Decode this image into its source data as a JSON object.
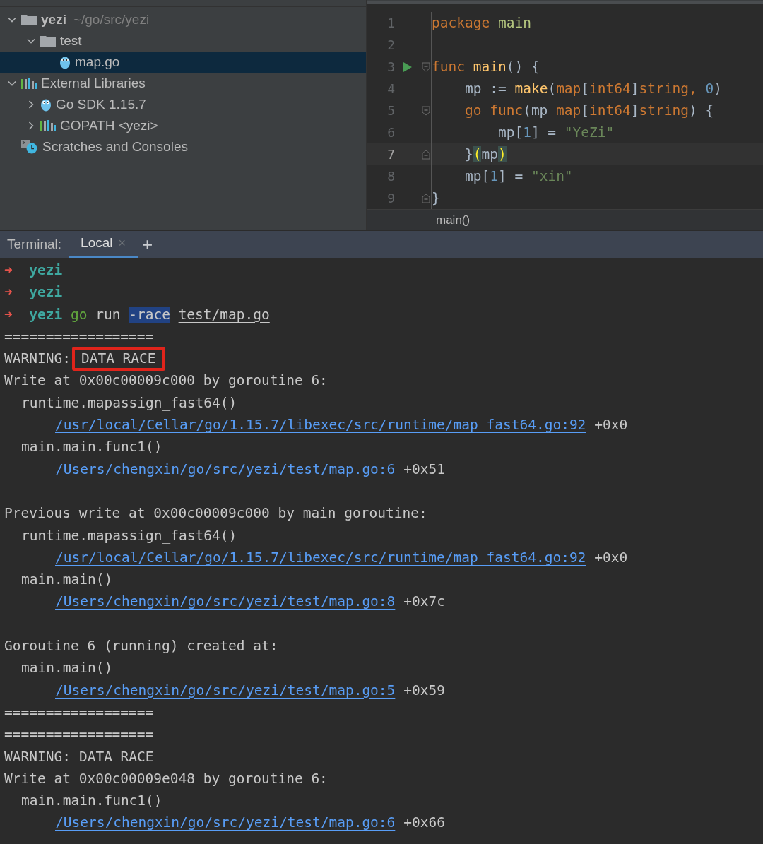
{
  "project_tree": [
    {
      "label": "yezi",
      "hint": "~/go/src/yezi",
      "kind": "project",
      "expanded": true,
      "selected": false,
      "children": [
        {
          "label": "test",
          "kind": "folder",
          "expanded": true,
          "selected": false,
          "children": [
            {
              "label": "map.go",
              "kind": "gofile",
              "selected": true
            }
          ]
        }
      ]
    },
    {
      "label": "External Libraries",
      "kind": "library",
      "expanded": true,
      "selected": false,
      "children": [
        {
          "label": "Go SDK 1.15.7",
          "kind": "gofile",
          "expanded": false,
          "selected": false
        },
        {
          "label": "GOPATH <yezi>",
          "kind": "library",
          "expanded": false,
          "selected": false
        }
      ]
    },
    {
      "label": "Scratches and Consoles",
      "kind": "scratches",
      "selected": false
    }
  ],
  "editor": {
    "lines": [
      {
        "number": "1",
        "current": false,
        "tokens": [
          {
            "t": "package ",
            "kind": "keyword"
          },
          {
            "t": "main",
            "kind": "pkg"
          }
        ]
      },
      {
        "number": "2",
        "current": false
      },
      {
        "number": "3",
        "current": false,
        "markers": [
          {
            "kind": "run"
          },
          {
            "kind": "fold_start"
          }
        ],
        "tokens": [
          {
            "t": "func ",
            "kind": "keyword"
          },
          {
            "t": "main",
            "kind": "func"
          },
          {
            "t": "() {",
            "kind": "plain"
          }
        ]
      },
      {
        "number": "4",
        "current": false,
        "tokens": [
          {
            "t": "    mp := ",
            "kind": "plain"
          },
          {
            "t": "make",
            "kind": "func"
          },
          {
            "t": "(",
            "kind": "plain"
          },
          {
            "t": "map",
            "kind": "keyword"
          },
          {
            "t": "[",
            "kind": "plain"
          },
          {
            "t": "int64",
            "kind": "keyword"
          },
          {
            "t": "]",
            "kind": "plain"
          },
          {
            "t": "string, ",
            "kind": "keyword"
          },
          {
            "t": "0",
            "kind": "number"
          },
          {
            "t": ")",
            "kind": "plain"
          }
        ]
      },
      {
        "number": "5",
        "current": false,
        "markers": [
          {
            "kind": "fold_start"
          }
        ],
        "tokens": [
          {
            "t": "    go func",
            "kind": "keyword"
          },
          {
            "t": "(mp ",
            "kind": "plain"
          },
          {
            "t": "map",
            "kind": "keyword"
          },
          {
            "t": "[",
            "kind": "plain"
          },
          {
            "t": "int64",
            "kind": "keyword"
          },
          {
            "t": "]",
            "kind": "plain"
          },
          {
            "t": "string",
            "kind": "keyword"
          },
          {
            "t": ") {",
            "kind": "plain"
          }
        ]
      },
      {
        "number": "6",
        "current": false,
        "tokens": [
          {
            "t": "        mp[",
            "kind": "plain"
          },
          {
            "t": "1",
            "kind": "number"
          },
          {
            "t": "] = ",
            "kind": "plain"
          },
          {
            "t": "\"YeZi\"",
            "kind": "string"
          }
        ]
      },
      {
        "number": "7",
        "current": true,
        "markers": [
          {
            "kind": "fold_end"
          }
        ],
        "tokens": [
          {
            "t": "    }",
            "kind": "plain"
          },
          {
            "t": "(",
            "kind": "brace"
          },
          {
            "t": "mp",
            "kind": "plain"
          },
          {
            "t": ")",
            "kind": "brace"
          }
        ]
      },
      {
        "number": "8",
        "current": false,
        "tokens": [
          {
            "t": "    mp[",
            "kind": "plain"
          },
          {
            "t": "1",
            "kind": "number"
          },
          {
            "t": "] = ",
            "kind": "plain"
          },
          {
            "t": "\"xin\"",
            "kind": "string"
          }
        ]
      },
      {
        "number": "9",
        "current": false,
        "markers": [
          {
            "kind": "fold_end"
          }
        ],
        "tokens": [
          {
            "t": "}",
            "kind": "plain"
          }
        ]
      }
    ],
    "breadcrumb": "main()"
  },
  "terminal": {
    "label": "Terminal:",
    "tabs": [
      {
        "label": "Local",
        "close": "×",
        "selected": true
      }
    ],
    "add": "+",
    "lines": [
      {
        "kind": "prompt",
        "segments": [
          {
            "t": "➜",
            "kind": "arrow"
          },
          {
            "t": "yezi",
            "kind": "dir"
          }
        ]
      },
      {
        "kind": "prompt",
        "segments": [
          {
            "t": "➜",
            "kind": "arrow"
          },
          {
            "t": "yezi",
            "kind": "dir"
          }
        ]
      },
      {
        "kind": "prompt",
        "segments": [
          {
            "t": "➜",
            "kind": "arrow"
          },
          {
            "t": "yezi",
            "kind": "dir"
          },
          {
            "t": "go",
            "kind": "cmd"
          },
          {
            "t": "run",
            "kind": "plain"
          },
          {
            "t": "-race",
            "kind": "selected"
          },
          {
            "t": "test/map.go",
            "kind": "path"
          }
        ]
      },
      {
        "kind": "text",
        "text": "=================="
      },
      {
        "kind": "warning",
        "label": "WARNING:",
        "text": "DATA RACE",
        "boxed": true
      },
      {
        "kind": "text",
        "text": "Write at 0x00c00009c000 by goroutine 6:"
      },
      {
        "kind": "trace",
        "text": "runtime.mapassign_fast64()"
      },
      {
        "kind": "link",
        "link": "/usr/local/Cellar/go/1.15.7/libexec/src/runtime/map_fast64.go:92",
        "suffix": "+0x0"
      },
      {
        "kind": "trace",
        "text": "main.main.func1()"
      },
      {
        "kind": "link",
        "link": "/Users/chengxin/go/src/yezi/test/map.go:6",
        "suffix": "+0x51"
      },
      {
        "kind": "blank"
      },
      {
        "kind": "text",
        "text": "Previous write at 0x00c00009c000 by main goroutine:"
      },
      {
        "kind": "trace",
        "text": "runtime.mapassign_fast64()"
      },
      {
        "kind": "link",
        "link": "/usr/local/Cellar/go/1.15.7/libexec/src/runtime/map_fast64.go:92",
        "suffix": "+0x0"
      },
      {
        "kind": "trace",
        "text": "main.main()"
      },
      {
        "kind": "link",
        "link": "/Users/chengxin/go/src/yezi/test/map.go:8",
        "suffix": "+0x7c"
      },
      {
        "kind": "blank"
      },
      {
        "kind": "text",
        "text": "Goroutine 6 (running) created at:"
      },
      {
        "kind": "trace",
        "text": "main.main()"
      },
      {
        "kind": "link",
        "link": "/Users/chengxin/go/src/yezi/test/map.go:5",
        "suffix": "+0x59"
      },
      {
        "kind": "text",
        "text": "=================="
      },
      {
        "kind": "text",
        "text": "=================="
      },
      {
        "kind": "warning",
        "label": "WARNING:",
        "text": "DATA RACE",
        "boxed": false
      },
      {
        "kind": "text",
        "text": "Write at 0x00c00009e048 by goroutine 6:"
      },
      {
        "kind": "trace",
        "text": "main.main.func1()"
      },
      {
        "kind": "link",
        "link": "/Users/chengxin/go/src/yezi/test/map.go:6",
        "suffix": "+0x66"
      }
    ]
  }
}
